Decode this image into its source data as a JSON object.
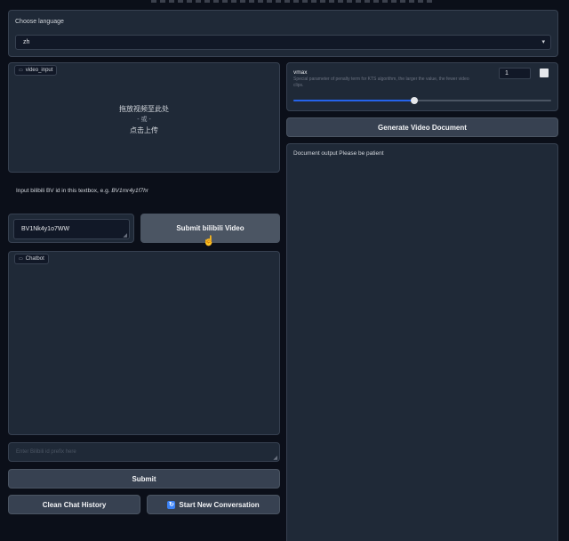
{
  "language": {
    "label": "Choose language",
    "value": "zh"
  },
  "video_input": {
    "tag": "video_input",
    "drop_text": "拖放视频至此处",
    "or_text": "- 或 -",
    "click_text": "点击上传"
  },
  "bv_hint": {
    "text": "Input bilibili BV id in this textbox, e.g.",
    "example": "BV1mr4y1f7hr"
  },
  "bv_input": {
    "value": "BV1Nk4y1o7WW"
  },
  "submit_video_label": "Submit bilibili Video",
  "chatbot": {
    "tag": "Chatbot"
  },
  "question_input": {
    "placeholder": "Enter Bilibili id prefix here"
  },
  "submit_label": "Submit",
  "clean_history_label": "Clean Chat History",
  "new_conv": {
    "icon": "refresh-icon",
    "label": "Start New Conversation"
  },
  "vmax": {
    "label": "vmax",
    "description": "Special parameter of penalty term for KTS algorithm, the larger the value, the fewer video clips.",
    "value": "1",
    "fraction": 0.47
  },
  "generate_label": "Generate Video Document",
  "doc_output": {
    "label": "Document output Please be patient"
  },
  "colors": {
    "background": "#0b0f19",
    "panel": "#1f2937",
    "button": "#374151",
    "slider": "#2563eb"
  }
}
